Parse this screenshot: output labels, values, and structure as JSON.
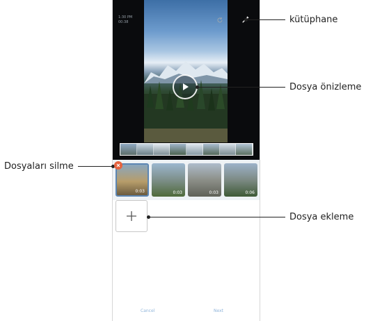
{
  "phone": {
    "status_left_lines": [
      "1:30 PM",
      "00:38"
    ],
    "thumbnails": [
      {
        "duration": "0:03",
        "colors": [
          "#8aa6bd",
          "#b79d6a",
          "#6b5b3f"
        ]
      },
      {
        "duration": "0:03",
        "colors": [
          "#9cb7cf",
          "#7d8f8a",
          "#4f6a3a"
        ]
      },
      {
        "duration": "0:03",
        "colors": [
          "#aebccb",
          "#8c8f88",
          "#5f6158"
        ]
      },
      {
        "duration": "0:06",
        "colors": [
          "#9db2c9",
          "#7c8a84",
          "#3e5a36"
        ]
      }
    ],
    "bottom_buttons": {
      "cancel": "Cancel",
      "next": "Next"
    }
  },
  "callouts": {
    "library": "kütüphane",
    "file_preview": "Dosya önizleme",
    "delete_files": "Dosyaları silme",
    "add_file": "Dosya ekleme"
  },
  "colors": {
    "accent": "#5c86b3",
    "delete_badge": "#e5633f",
    "preview_bg": "#0a0b0d",
    "strip_bg": "#eef2f5"
  }
}
